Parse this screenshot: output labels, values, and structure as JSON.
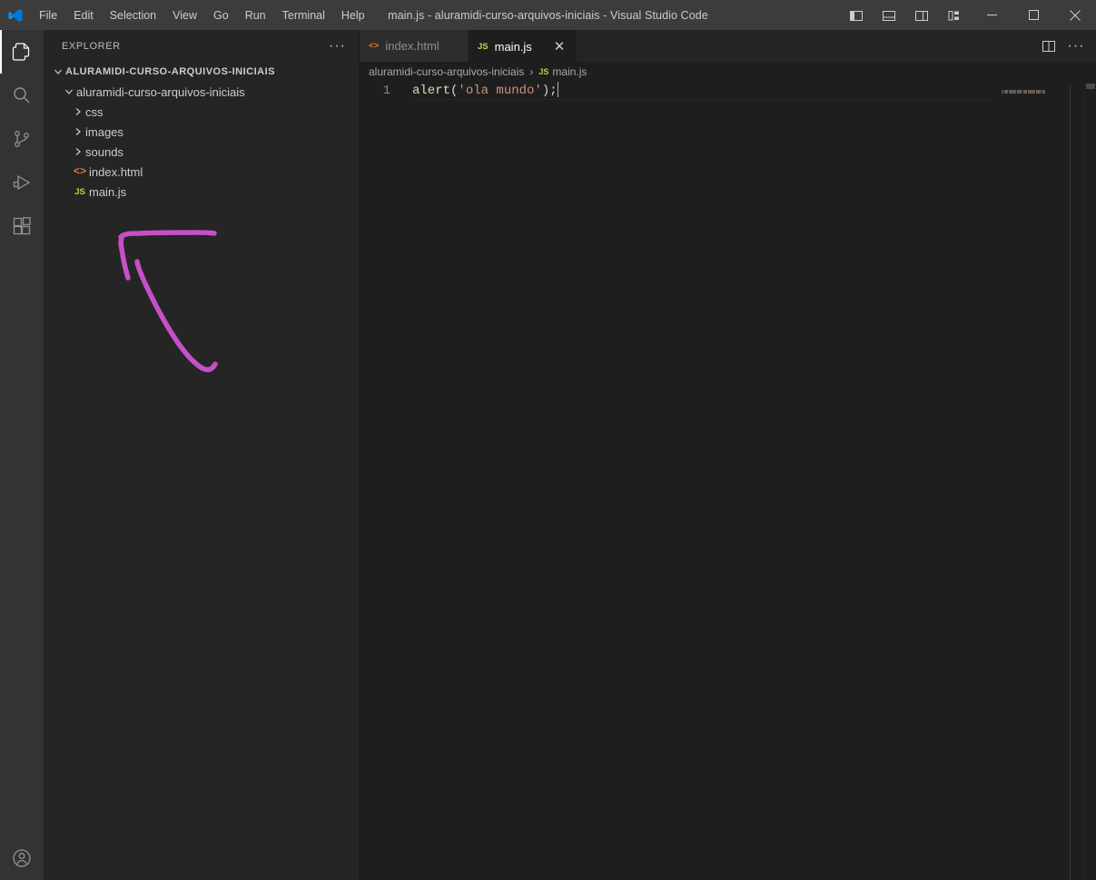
{
  "titlebar": {
    "logo_icon": "vscode-logo-icon",
    "title": "main.js - aluramidi-curso-arquivos-iniciais - Visual Studio Code",
    "menus": [
      {
        "label": "File"
      },
      {
        "label": "Edit"
      },
      {
        "label": "Selection"
      },
      {
        "label": "View"
      },
      {
        "label": "Go"
      },
      {
        "label": "Run"
      },
      {
        "label": "Terminal"
      },
      {
        "label": "Help"
      }
    ],
    "layout_buttons": [
      {
        "name": "toggle-primary-sidebar-icon",
        "tooltip": "Toggle Primary Side Bar"
      },
      {
        "name": "toggle-panel-icon",
        "tooltip": "Toggle Panel"
      },
      {
        "name": "toggle-secondary-sidebar-icon",
        "tooltip": "Toggle Secondary Side Bar"
      },
      {
        "name": "customize-layout-icon",
        "tooltip": "Customize Layout"
      }
    ],
    "window_buttons": [
      {
        "name": "minimize-icon",
        "glyph": "─"
      },
      {
        "name": "maximize-icon",
        "glyph": "□"
      },
      {
        "name": "close-icon",
        "glyph": "✕"
      }
    ]
  },
  "activitybar": {
    "items": [
      {
        "name": "explorer-icon",
        "label": "Explorer",
        "active": true
      },
      {
        "name": "search-icon",
        "label": "Search",
        "active": false
      },
      {
        "name": "source-control-icon",
        "label": "Source Control",
        "active": false
      },
      {
        "name": "run-and-debug-icon",
        "label": "Run and Debug",
        "active": false
      },
      {
        "name": "extensions-icon",
        "label": "Extensions",
        "active": false
      }
    ],
    "bottom_items": [
      {
        "name": "accounts-icon",
        "label": "Accounts"
      }
    ]
  },
  "sidebar": {
    "title": "EXPLORER",
    "more_actions": "···",
    "tree": [
      {
        "kind": "root",
        "label": "ALURAMIDI-CURSO-ARQUIVOS-INICIAIS",
        "expanded": true,
        "indent": 0
      },
      {
        "kind": "folder",
        "label": "aluramidi-curso-arquivos-iniciais",
        "expanded": true,
        "indent": 1
      },
      {
        "kind": "folder",
        "label": "css",
        "expanded": false,
        "indent": 2
      },
      {
        "kind": "folder",
        "label": "images",
        "expanded": false,
        "indent": 2
      },
      {
        "kind": "folder",
        "label": "sounds",
        "expanded": false,
        "indent": 2
      },
      {
        "kind": "file",
        "label": "index.html",
        "icon": "html-file-icon",
        "icon_text": "<>",
        "indent": 2
      },
      {
        "kind": "file",
        "label": "main.js",
        "icon": "js-file-icon",
        "icon_text": "JS",
        "indent": 2
      }
    ],
    "annotation": {
      "name": "pink-handdrawn-arrow-annotation",
      "color": "#c74fc7"
    }
  },
  "editor": {
    "tabs": [
      {
        "label": "index.html",
        "icon_text": "<>",
        "icon_color": "#e37933",
        "active": false,
        "closable": false
      },
      {
        "label": "main.js",
        "icon_text": "JS",
        "icon_color": "#cbcb41",
        "active": true,
        "closable": true,
        "close_glyph": "✕"
      }
    ],
    "tab_actions": [
      {
        "name": "split-editor-right-icon"
      },
      {
        "name": "more-actions-icon",
        "glyph": "···"
      }
    ],
    "breadcrumbs": [
      {
        "label": "aluramidi-curso-arquivos-iniciais",
        "icon": null
      },
      {
        "label": "main.js",
        "icon": "js-file-icon",
        "icon_text": "JS"
      }
    ],
    "breadcrumb_separator": "›",
    "code": {
      "language": "javascript",
      "lines": [
        {
          "number": "1",
          "tokens": [
            {
              "text": "alert",
              "type": "function"
            },
            {
              "text": "(",
              "type": "paren"
            },
            {
              "text": "'ola mundo'",
              "type": "string"
            },
            {
              "text": ")",
              "type": "paren"
            },
            {
              "text": ";",
              "type": "punct"
            }
          ],
          "plain": "alert('ola mundo');"
        }
      ]
    },
    "minimap_visible": true
  },
  "colors": {
    "titlebar_bg": "#3c3c3c",
    "activitybar_bg": "#333333",
    "sidebar_bg": "#252526",
    "editor_bg": "#1e1e1e",
    "tab_inactive_bg": "#2d2d2d",
    "tab_active_bg": "#1e1e1e",
    "text": "#cccccc",
    "line_number": "#858585",
    "accent_js": "#cbcb41",
    "accent_html": "#e37933",
    "string_token": "#ce9178",
    "function_token": "#dcdcaa",
    "annotation_pink": "#c74fc7"
  }
}
